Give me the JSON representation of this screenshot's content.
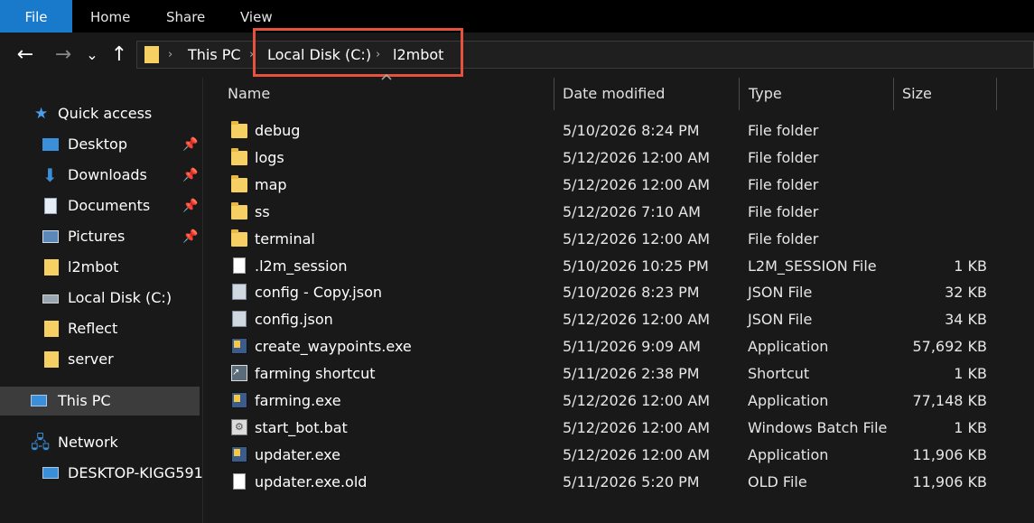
{
  "ribbon": {
    "tabs": [
      "File",
      "Home",
      "Share",
      "View"
    ]
  },
  "nav": {
    "back_glyph": "←",
    "forward_glyph": "→",
    "recent_glyph": "⌄",
    "up_glyph": "↑",
    "breadcrumb": [
      "This PC",
      "Local Disk (C:)",
      "l2mbot"
    ],
    "separator": "›"
  },
  "sidebar": {
    "quick_access": "Quick access",
    "pinned": [
      {
        "label": "Desktop",
        "icon": "desktop-icon"
      },
      {
        "label": "Downloads",
        "icon": "download-icon"
      },
      {
        "label": "Documents",
        "icon": "documents-icon"
      },
      {
        "label": "Pictures",
        "icon": "pictures-icon"
      }
    ],
    "recent": [
      {
        "label": "l2mbot",
        "icon": "folder-icon"
      },
      {
        "label": "Local Disk (C:)",
        "icon": "drive-icon"
      },
      {
        "label": "Reflect",
        "icon": "folder-icon"
      },
      {
        "label": "server",
        "icon": "folder-icon"
      }
    ],
    "this_pc": "This PC",
    "network": "Network",
    "network_child": "DESKTOP-KIGG591"
  },
  "columns": {
    "name": "Name",
    "date": "Date modified",
    "type": "Type",
    "size": "Size"
  },
  "files": [
    {
      "name": "debug",
      "date": "5/10/2026 8:24 PM",
      "type": "File folder",
      "size": "",
      "icon": "folder"
    },
    {
      "name": "logs",
      "date": "5/12/2026 12:00 AM",
      "type": "File folder",
      "size": "",
      "icon": "folder"
    },
    {
      "name": "map",
      "date": "5/12/2026 12:00 AM",
      "type": "File folder",
      "size": "",
      "icon": "folder"
    },
    {
      "name": "ss",
      "date": "5/12/2026 7:10 AM",
      "type": "File folder",
      "size": "",
      "icon": "folder"
    },
    {
      "name": "terminal",
      "date": "5/12/2026 12:00 AM",
      "type": "File folder",
      "size": "",
      "icon": "folder"
    },
    {
      "name": ".l2m_session",
      "date": "5/10/2026 10:25 PM",
      "type": "L2M_SESSION File",
      "size": "1 KB",
      "icon": "doc"
    },
    {
      "name": "config - Copy.json",
      "date": "5/10/2026 8:23 PM",
      "type": "JSON File",
      "size": "32 KB",
      "icon": "json"
    },
    {
      "name": "config.json",
      "date": "5/12/2026 12:00 AM",
      "type": "JSON File",
      "size": "34 KB",
      "icon": "json"
    },
    {
      "name": "create_waypoints.exe",
      "date": "5/11/2026 9:09 AM",
      "type": "Application",
      "size": "57,692 KB",
      "icon": "exe"
    },
    {
      "name": "farming shortcut",
      "date": "5/11/2026 2:38 PM",
      "type": "Shortcut",
      "size": "1 KB",
      "icon": "lnk"
    },
    {
      "name": "farming.exe",
      "date": "5/12/2026 12:00 AM",
      "type": "Application",
      "size": "77,148 KB",
      "icon": "exe"
    },
    {
      "name": "start_bot.bat",
      "date": "5/12/2026 12:00 AM",
      "type": "Windows Batch File",
      "size": "1 KB",
      "icon": "bat"
    },
    {
      "name": "updater.exe",
      "date": "5/12/2026 12:00 AM",
      "type": "Application",
      "size": "11,906 KB",
      "icon": "exe"
    },
    {
      "name": "updater.exe.old",
      "date": "5/11/2026 5:20 PM",
      "type": "OLD File",
      "size": "11,906 KB",
      "icon": "doc"
    }
  ],
  "colors": {
    "accent": "#1979ca",
    "highlight_box": "#e5533f",
    "folder": "#f7d064",
    "background": "#191919"
  }
}
